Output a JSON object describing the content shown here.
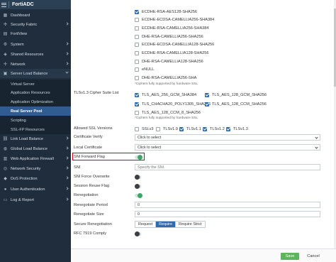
{
  "app": {
    "title": "FortiADC"
  },
  "sidebar": {
    "items": [
      {
        "label": "Dashboard",
        "icon": "dashboard-icon",
        "glyph": "▦"
      },
      {
        "label": "Security Fabric",
        "icon": "security-fabric-icon",
        "glyph": "✣"
      },
      {
        "label": "FortiView",
        "icon": "fortiview-icon",
        "glyph": "▤"
      },
      {
        "label": "System",
        "icon": "gear-icon",
        "glyph": "⚙"
      },
      {
        "label": "Shared Resources",
        "icon": "shared-resources-icon",
        "glyph": "◈"
      },
      {
        "label": "Network",
        "icon": "network-icon",
        "glyph": "✢"
      },
      {
        "label": "Server Load Balance",
        "icon": "server-load-balance-icon",
        "glyph": "▣"
      },
      {
        "label": "Virtual Server"
      },
      {
        "label": "Application Resources"
      },
      {
        "label": "Application Optimization"
      },
      {
        "label": "Real Server Pool"
      },
      {
        "label": "Scripting"
      },
      {
        "label": "SSL-FP Resources"
      },
      {
        "label": "Link Load Balance",
        "icon": "link-load-balance-icon",
        "glyph": "⛓"
      },
      {
        "label": "Global Load Balance",
        "icon": "globe-icon",
        "glyph": "◍"
      },
      {
        "label": "Web Application Firewall",
        "icon": "firewall-icon",
        "glyph": "▥"
      },
      {
        "label": "Network Security",
        "icon": "network-security-icon",
        "glyph": "◎"
      },
      {
        "label": "DoS Protection",
        "icon": "shield-icon",
        "glyph": "◆"
      },
      {
        "label": "User Authentication",
        "icon": "user-icon",
        "glyph": "●"
      },
      {
        "label": "Log & Report",
        "icon": "log-report-icon",
        "glyph": "▭"
      }
    ]
  },
  "ciphers": [
    {
      "label": "ECDHE-RSA-AES128-SHA256",
      "checked": true
    },
    {
      "label": "ECDHE-ECDSA-CAMELLIA256-SHA384",
      "checked": false
    },
    {
      "label": "ECDHE-RSA-CAMELLIA256-SHA384",
      "checked": false
    },
    {
      "label": "DHE-RSA-CAMELLIA256-SHA256",
      "checked": false
    },
    {
      "label": "ECDHE-ECDSA-CAMELLIA128-SHA256",
      "checked": false
    },
    {
      "label": "ECDHE-RSA-CAMELLIA128-SHA256",
      "checked": false
    },
    {
      "label": "DHE-RSA-CAMELLIA128-SHA256",
      "checked": false
    },
    {
      "label": "eNULL",
      "checked": false
    },
    {
      "label": "DHE-RSA-CAMELLIA256-SHA",
      "checked": false
    }
  ],
  "hw_note": "*Ciphers fully supported by hardware SSL",
  "tls13": {
    "label": "TLSv1.3 Cipher Suite List",
    "options": [
      {
        "label": "TLS_AES_256_GCM_SHA384",
        "checked": true
      },
      {
        "label": "TLS_AES_128_GCM_SHA256",
        "checked": true
      },
      {
        "label": "TLS_CHACHA20_POLY1305_SHA256",
        "checked": true
      },
      {
        "label": "TLS_AES_128_CCM_SHA256",
        "checked": true
      },
      {
        "label": "TLS_AES_128_CCM_8_SHA256",
        "checked": false
      }
    ],
    "note": "*Ciphers fully supported by hardware SSL"
  },
  "ssl_versions": {
    "label": "Allowed SSL Versions",
    "options": [
      {
        "label": "SSLv3",
        "checked": false
      },
      {
        "label": "TLSv1.0",
        "checked": false
      },
      {
        "label": "TLSv1.1",
        "checked": true
      },
      {
        "label": "TLSv1.2",
        "checked": true
      },
      {
        "label": "TLSv1.3",
        "checked": true
      }
    ]
  },
  "form": {
    "certificate_verify": {
      "label": "Certificate Verify",
      "value": "Click to select"
    },
    "local_certificate": {
      "label": "Local Certificate",
      "value": "Click to select"
    },
    "sni_forward_flag": {
      "label": "SNI Forward Flag",
      "on": true
    },
    "sni": {
      "label": "SNI",
      "placeholder": "Specify the SNI."
    },
    "sni_force_overwrite": {
      "label": "SNI Force Overwrite",
      "on": false
    },
    "session_reuse_flag": {
      "label": "Session Reuse Flag",
      "on": false
    },
    "renegotiation": {
      "label": "Renegotiation",
      "on": true
    },
    "renegotiate_period": {
      "label": "Renegotiate Period",
      "value": "0"
    },
    "renegotiate_size": {
      "label": "Renegotiate Size",
      "value": "0"
    },
    "secure_renegotiation": {
      "label": "Secure Renegotiation",
      "options": [
        "Request",
        "Require",
        "Require Strict"
      ],
      "selected": "Require"
    },
    "rfc7919": {
      "label": "RFC 7919 Comply",
      "on": false
    }
  },
  "footer": {
    "save": "Save",
    "cancel": "Cancel"
  },
  "colors": {
    "accent": "#2f6bb0",
    "sidebar": "#1f2d3c",
    "active": "#2f5d91",
    "highlight": "#d0021b",
    "save": "#62b35e"
  }
}
